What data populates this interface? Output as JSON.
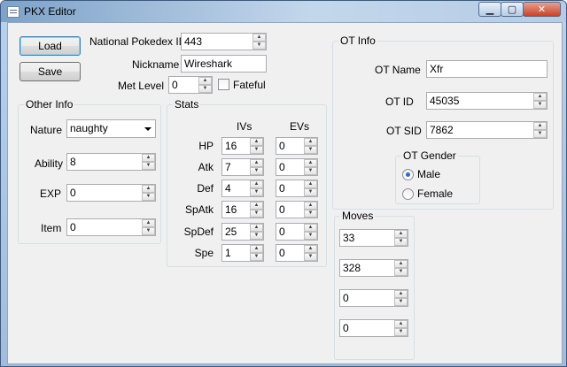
{
  "window": {
    "title": "PKX Editor",
    "minimize": "▁",
    "maximize": "▢",
    "close": "✕"
  },
  "actions": {
    "load": "Load",
    "save": "Save"
  },
  "main": {
    "dex_label": "National Pokedex ID",
    "dex_value": "443",
    "nickname_label": "Nickname",
    "nickname_value": "Wireshark",
    "metlevel_label": "Met Level",
    "metlevel_value": "0",
    "fateful_label": "Fateful"
  },
  "other_info": {
    "title": "Other Info",
    "nature_label": "Nature",
    "nature_value": "naughty",
    "ability_label": "Ability",
    "ability_value": "8",
    "exp_label": "EXP",
    "exp_value": "0",
    "item_label": "Item",
    "item_value": "0"
  },
  "stats": {
    "title": "Stats",
    "ivs_header": "IVs",
    "evs_header": "EVs",
    "rows": [
      {
        "label": "HP",
        "iv": "16",
        "ev": "0"
      },
      {
        "label": "Atk",
        "iv": "7",
        "ev": "0"
      },
      {
        "label": "Def",
        "iv": "4",
        "ev": "0"
      },
      {
        "label": "SpAtk",
        "iv": "16",
        "ev": "0"
      },
      {
        "label": "SpDef",
        "iv": "25",
        "ev": "0"
      },
      {
        "label": "Spe",
        "iv": "1",
        "ev": "0"
      }
    ]
  },
  "ot_info": {
    "title": "OT Info",
    "name_label": "OT Name",
    "name_value": "Xfr",
    "id_label": "OT ID",
    "id_value": "45035",
    "sid_label": "OT SID",
    "sid_value": "7862",
    "gender_title": "OT Gender",
    "male": "Male",
    "female": "Female",
    "selected": "Male"
  },
  "moves": {
    "title": "Moves",
    "values": [
      "33",
      "328",
      "0",
      "0"
    ]
  }
}
